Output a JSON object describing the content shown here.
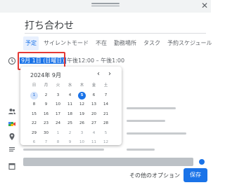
{
  "header": {
    "close_glyph": "✕"
  },
  "event": {
    "title_placeholder": "打ち合わせ",
    "date": "9月 1日 (日曜日)",
    "time_range": "午後12:00 – 午後1:00"
  },
  "tabs": [
    {
      "label": "予定",
      "active": true
    },
    {
      "label": "サイレントモード",
      "active": false
    },
    {
      "label": "不在",
      "active": false
    },
    {
      "label": "勤務場所",
      "active": false
    },
    {
      "label": "タスク",
      "active": false
    },
    {
      "label": "予約スケジュール",
      "active": false
    }
  ],
  "calendar": {
    "month_label": "2024年 9月",
    "prev_glyph": "‹",
    "next_glyph": "›",
    "weekdays": [
      "日",
      "月",
      "火",
      "水",
      "木",
      "金",
      "土"
    ],
    "selected_day": "1",
    "today": "5",
    "weeks": [
      [
        [
          "1",
          ""
        ],
        [
          "2",
          ""
        ],
        [
          "3",
          ""
        ],
        [
          "4",
          ""
        ],
        [
          "5",
          ""
        ],
        [
          "6",
          ""
        ],
        [
          "7",
          ""
        ]
      ],
      [
        [
          "8",
          ""
        ],
        [
          "9",
          ""
        ],
        [
          "10",
          ""
        ],
        [
          "11",
          ""
        ],
        [
          "12",
          ""
        ],
        [
          "13",
          ""
        ],
        [
          "14",
          ""
        ]
      ],
      [
        [
          "15",
          ""
        ],
        [
          "16",
          ""
        ],
        [
          "17",
          ""
        ],
        [
          "18",
          ""
        ],
        [
          "19",
          ""
        ],
        [
          "20",
          ""
        ],
        [
          "21",
          ""
        ]
      ],
      [
        [
          "22",
          ""
        ],
        [
          "23",
          ""
        ],
        [
          "24",
          ""
        ],
        [
          "25",
          ""
        ],
        [
          "26",
          ""
        ],
        [
          "27",
          ""
        ],
        [
          "28",
          ""
        ]
      ],
      [
        [
          "29",
          ""
        ],
        [
          "30",
          ""
        ],
        [
          "1",
          "muted"
        ],
        [
          "2",
          "muted"
        ],
        [
          "3",
          "muted"
        ],
        [
          "4",
          "muted"
        ],
        [
          "5",
          "muted"
        ]
      ],
      [
        [
          "6",
          "muted"
        ],
        [
          "7",
          "muted"
        ],
        [
          "8",
          "muted"
        ],
        [
          "9",
          "muted"
        ],
        [
          "10",
          "muted"
        ],
        [
          "11",
          "muted"
        ],
        [
          "12",
          "muted"
        ]
      ]
    ]
  },
  "footer": {
    "more_options_label": "その他のオプション",
    "save_label": "保存"
  },
  "colors": {
    "accent": "#1a73e8",
    "highlight": "#e53935"
  }
}
